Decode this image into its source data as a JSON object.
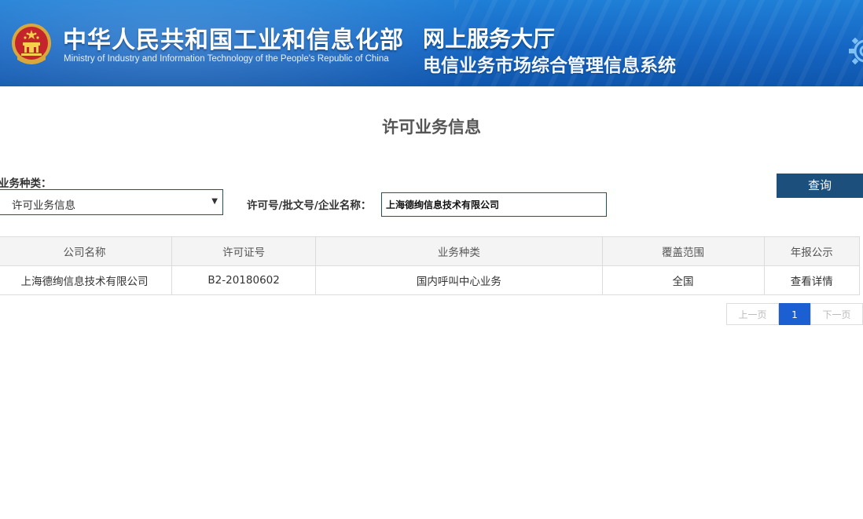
{
  "header": {
    "title_cn": "中华人民共和国工业和信息化部",
    "title_en": "Ministry of Industry and Information Technology of the People's Republic of China",
    "service_hall": "网上服务大厅",
    "system_name": "电信业务市场综合管理信息系统",
    "emblem_icon": "national-emblem-icon",
    "gear_icon": "gear-icon"
  },
  "page": {
    "title": "许可业务信息"
  },
  "search": {
    "type_label": "业务种类：",
    "type_selected": "许可业务信息",
    "license_label": "许可号/批文号/企业名称：",
    "license_value": "上海德绚信息技术有限公司",
    "query_button": "查询"
  },
  "table": {
    "headers": [
      "公司名称",
      "许可证号",
      "业务种类",
      "覆盖范围",
      "年报公示"
    ],
    "rows": [
      [
        "上海德绚信息技术有限公司",
        "B2-20180602",
        "国内呼叫中心业务",
        "全国",
        "查看详情"
      ]
    ]
  },
  "pagination": {
    "prev": "上一页",
    "current": "1",
    "next": "下一页"
  },
  "colors": {
    "banner": "#1566c3",
    "primary": "#1d4f7c",
    "pager_active": "#1b5fd3"
  }
}
